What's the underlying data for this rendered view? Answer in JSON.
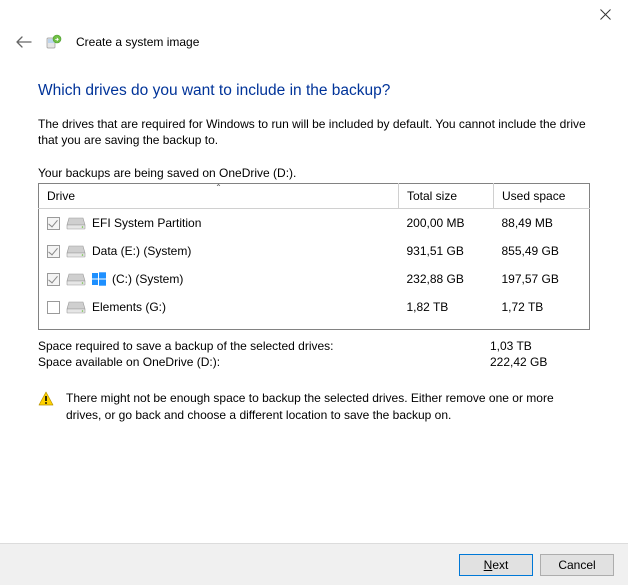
{
  "window": {
    "title": "Create a system image"
  },
  "page": {
    "heading": "Which drives do you want to include in the backup?",
    "description": "The drives that are required for Windows to run will be included by default. You cannot include the drive that you are saving the backup to.",
    "saved_on": "Your backups are being saved on OneDrive (D:)."
  },
  "table": {
    "columns": {
      "drive": "Drive",
      "total": "Total size",
      "used": "Used space"
    },
    "rows": [
      {
        "checked": true,
        "disabled": true,
        "winlogo": false,
        "name": "EFI System Partition",
        "total": "200,00 MB",
        "used": "88,49 MB"
      },
      {
        "checked": true,
        "disabled": true,
        "winlogo": false,
        "name": "Data (E:) (System)",
        "total": "931,51 GB",
        "used": "855,49 GB"
      },
      {
        "checked": true,
        "disabled": true,
        "winlogo": true,
        "name": "(C:) (System)",
        "total": "232,88 GB",
        "used": "197,57 GB"
      },
      {
        "checked": false,
        "disabled": false,
        "winlogo": false,
        "name": "Elements (G:)",
        "total": "1,82 TB",
        "used": "1,72 TB"
      }
    ]
  },
  "summary": {
    "required_label": "Space required to save a backup of the selected drives:",
    "required_value": "1,03 TB",
    "available_label": "Space available on OneDrive (D:):",
    "available_value": "222,42 GB"
  },
  "warning": {
    "text": "There might not be enough space to backup the selected drives. Either remove one or more drives, or go back and choose a different location to save the backup on."
  },
  "buttons": {
    "next": "Next",
    "cancel": "Cancel"
  }
}
